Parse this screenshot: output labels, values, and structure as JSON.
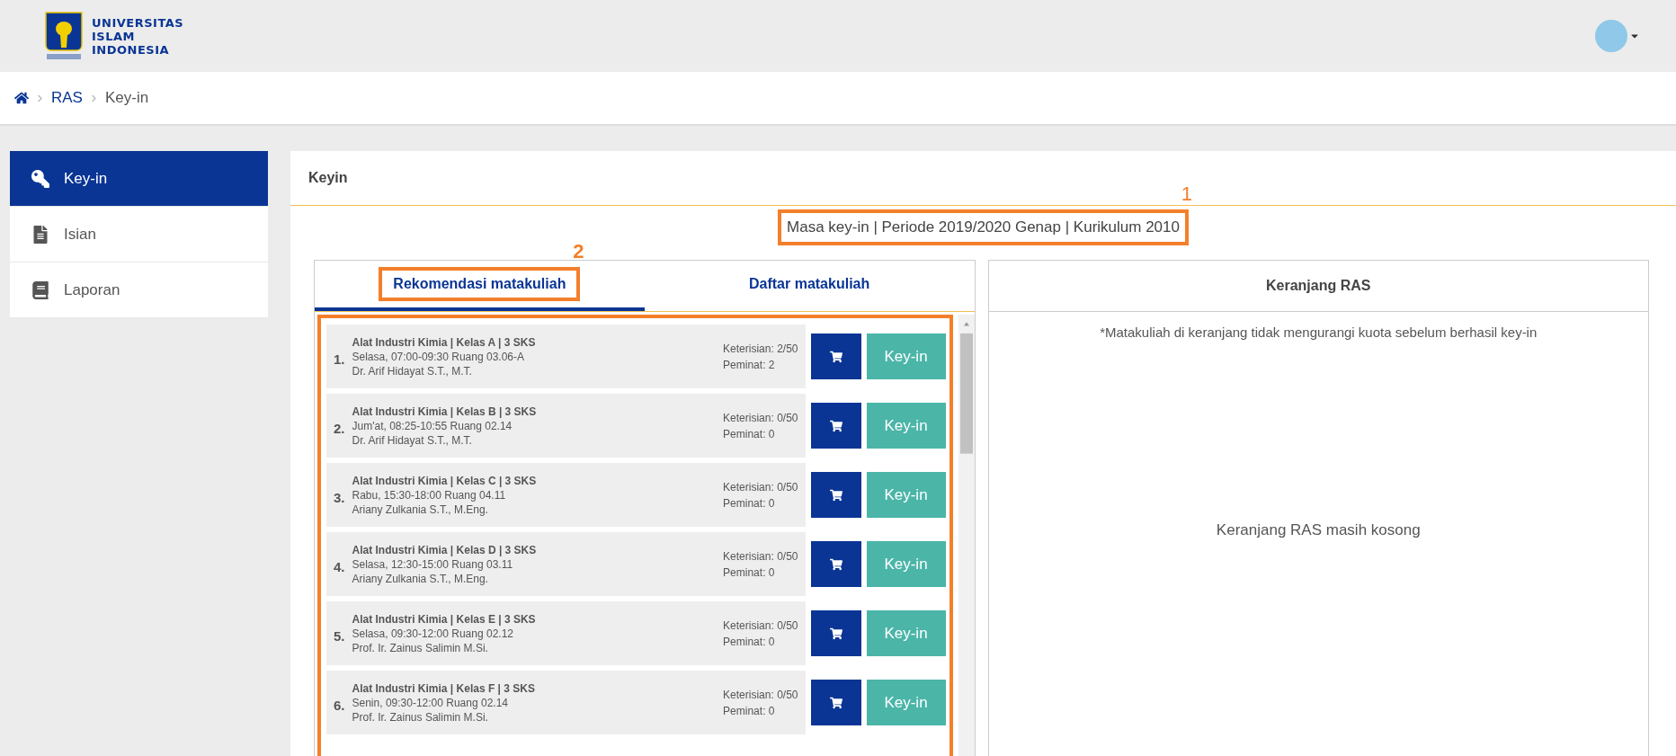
{
  "header": {
    "logo_lines": [
      "UNIVERSITAS",
      "ISLAM",
      "INDONESIA"
    ]
  },
  "breadcrumb": [
    {
      "label": "RAS",
      "kind": "link"
    },
    {
      "label": "Key-in",
      "kind": "current"
    }
  ],
  "sidebar": {
    "items": [
      {
        "label": "Key-in",
        "kind": "key",
        "selected": true
      },
      {
        "label": "Isian",
        "kind": "document",
        "selected": false
      },
      {
        "label": "Laporan",
        "kind": "book",
        "selected": false
      }
    ]
  },
  "panel": {
    "title": "Keyin",
    "period": {
      "text": "Masa key-in | Periode 2019/2020 Genap | Kurikulum 2010",
      "annotation": "1"
    }
  },
  "left_card": {
    "tabs": [
      {
        "label": "Rekomendasi matakuliah",
        "selected": true,
        "annotation": "2"
      },
      {
        "label": "Daftar matakuliah",
        "selected": false
      }
    ],
    "courses": [
      {
        "number": "1.",
        "title": "Alat Industri Kimia | Kelas A | 3 SKS",
        "schedule": "Selasa, 07:00-09:30 Ruang 03.06-A",
        "lecturer": "Dr. Arif Hidayat S.T., M.T.",
        "filled": "Keterisian: 2/50",
        "interested": "Peminat: 2",
        "action": "Key-in"
      },
      {
        "number": "2.",
        "title": "Alat Industri Kimia | Kelas B | 3 SKS",
        "schedule": "Jum'at, 08:25-10:55 Ruang 02.14",
        "lecturer": "Dr. Arif Hidayat S.T., M.T.",
        "filled": "Keterisian: 0/50",
        "interested": "Peminat: 0",
        "action": "Key-in"
      },
      {
        "number": "3.",
        "title": "Alat Industri Kimia | Kelas C | 3 SKS",
        "schedule": "Rabu, 15:30-18:00 Ruang 04.11",
        "lecturer": "Ariany Zulkania S.T., M.Eng.",
        "filled": "Keterisian: 0/50",
        "interested": "Peminat: 0",
        "action": "Key-in"
      },
      {
        "number": "4.",
        "title": "Alat Industri Kimia | Kelas D | 3 SKS",
        "schedule": "Selasa, 12:30-15:00 Ruang 03.11",
        "lecturer": "Ariany Zulkania S.T., M.Eng.",
        "filled": "Keterisian: 0/50",
        "interested": "Peminat: 0",
        "action": "Key-in"
      },
      {
        "number": "5.",
        "title": "Alat Industri Kimia | Kelas E | 3 SKS",
        "schedule": "Selasa, 09:30-12:00 Ruang 02.12",
        "lecturer": "Prof. Ir. Zainus Salimin M.Si.",
        "filled": "Keterisian: 0/50",
        "interested": "Peminat: 0",
        "action": "Key-in"
      },
      {
        "number": "6.",
        "title": "Alat Industri Kimia | Kelas F | 3 SKS",
        "schedule": "Senin, 09:30-12:00 Ruang 02.14",
        "lecturer": "Prof. Ir. Zainus Salimin M.Si.",
        "filled": "Keterisian: 0/50",
        "interested": "Peminat: 0",
        "action": "Key-in"
      }
    ]
  },
  "right_card": {
    "title": "Keranjang RAS",
    "note": "*Matakuliah di keranjang tidak mengurangi kuota sebelum berhasil key-in",
    "empty_message": "Keranjang RAS masih kosong"
  }
}
